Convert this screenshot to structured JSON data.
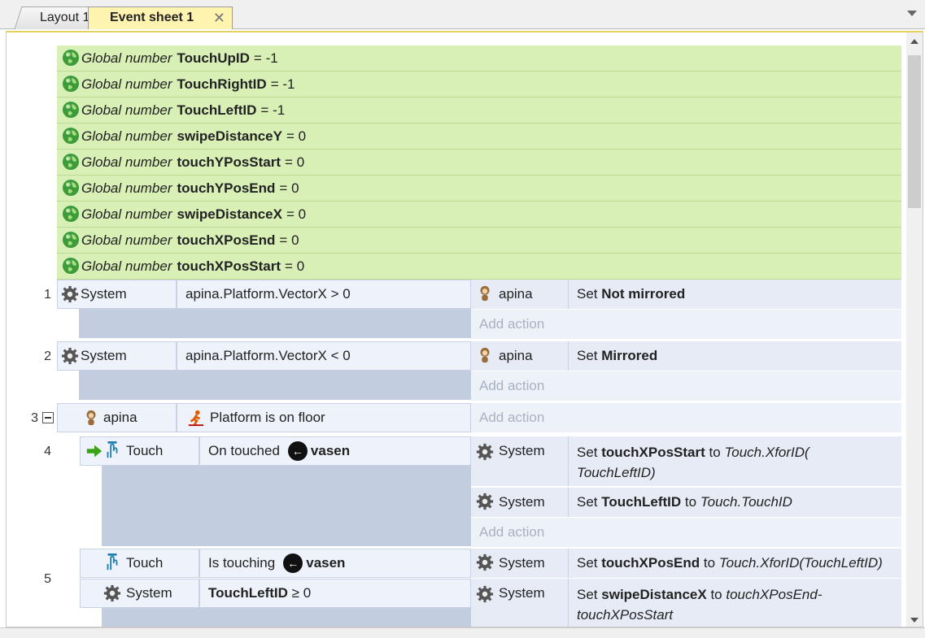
{
  "tabs": [
    {
      "label": "Layout 1"
    },
    {
      "label": "Event sheet 1"
    }
  ],
  "globals_label": "Global number",
  "globals": [
    {
      "name": "TouchUpID",
      "value": "= -1"
    },
    {
      "name": "TouchRightID",
      "value": "= -1"
    },
    {
      "name": "TouchLeftID",
      "value": "= -1"
    },
    {
      "name": "swipeDistanceY",
      "value": "= 0"
    },
    {
      "name": "touchYPosStart",
      "value": "= 0"
    },
    {
      "name": "touchYPosEnd",
      "value": "= 0"
    },
    {
      "name": "swipeDistanceX",
      "value": "= 0"
    },
    {
      "name": "touchXPosEnd",
      "value": "= 0"
    },
    {
      "name": "touchXPosStart",
      "value": "= 0"
    }
  ],
  "add_action": "Add action",
  "events": {
    "e1": {
      "number": "1",
      "cond_obj": "System",
      "cond_text": "apina.Platform.VectorX > 0",
      "act_obj": "apina",
      "act_prefix": "Set",
      "act_bold": "Not mirrored"
    },
    "e2": {
      "number": "2",
      "cond_obj": "System",
      "cond_text": "apina.Platform.VectorX < 0",
      "act_obj": "apina",
      "act_prefix": "Set",
      "act_bold": "Mirrored"
    },
    "e3": {
      "number": "3",
      "cond_obj": "apina",
      "cond_text": "Platform is on floor"
    },
    "e4": {
      "number": "4",
      "cond_obj": "Touch",
      "cond_text": "On touched",
      "cond_bold": "vasen",
      "act1_obj": "System",
      "act1_prefix": "Set",
      "act1_bold": "touchXPosStart",
      "act1_to": "to",
      "act1_expr": "Touch.XforID(",
      "act1_expr2": "TouchLeftID)",
      "act2_obj": "System",
      "act2_prefix": "Set",
      "act2_bold": "TouchLeftID",
      "act2_to": "to",
      "act2_expr": "Touch.TouchID"
    },
    "e5": {
      "number": "5",
      "cond1_obj": "Touch",
      "cond1_text": "Is touching",
      "cond1_bold": "vasen",
      "cond2_obj": "System",
      "cond2_bold": "TouchLeftID",
      "cond2_text": "≥ 0",
      "act1_obj": "System",
      "act1_prefix": "Set",
      "act1_bold": "touchXPosEnd",
      "act1_to": "to",
      "act1_expr": "Touch.XforID(TouchLeftID)",
      "act2_obj": "System",
      "act2_prefix": "Set",
      "act2_bold": "swipeDistanceX",
      "act2_to": "to",
      "act2_expr": "touchXPosEnd-",
      "act2_expr2": "touchXPosStart"
    }
  },
  "colors": {
    "global_bg": "#d8efb6",
    "active_tab": "#fff3b0",
    "condition_bg": "#eef2fa",
    "action_bg": "#e6ebf5"
  }
}
